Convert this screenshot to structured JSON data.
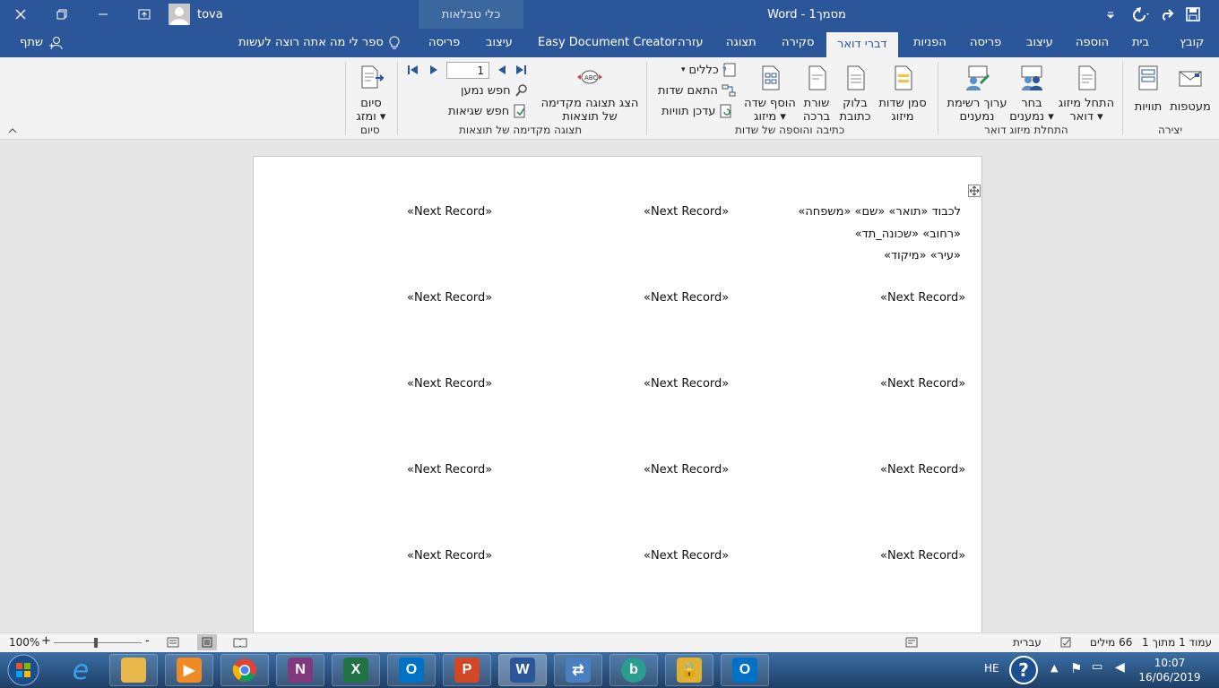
{
  "colors": {
    "accent": "#2b579a",
    "ribbon_bg": "#f3f3f3",
    "canvas_bg": "#e6e6e6"
  },
  "titlebar": {
    "doc_title": "מסמך1  -  Word",
    "context_label": "כלי טבלאות",
    "user": "tova",
    "icons": [
      "save-icon",
      "redo-icon",
      "undo-icon",
      "customize-qat-icon",
      "ribbon-options-icon",
      "minimize-icon",
      "restore-icon",
      "close-icon"
    ]
  },
  "tabs": {
    "file": "קובץ",
    "home": "בית",
    "insert": "הוספה",
    "design": "עיצוב",
    "layout": "פריסה",
    "references": "הפניות",
    "mailings": "דברי דואר",
    "review": "סקירה",
    "view": "תצוגה",
    "help": "עזרה",
    "addin": "Easy Document Creator",
    "table_design": "עיצוב",
    "table_layout": "פריסה",
    "tell_me": "ספר לי מה אתה רוצה לעשות",
    "share": "שתף"
  },
  "ribbon": {
    "envelopes": "מעטפות",
    "labels": "תוויות",
    "create_group": "יצירה",
    "start_merge": "התחל מיזוג",
    "start_merge2": "דואר",
    "select_recipients": "בחר",
    "select_recipients2": "נמענים",
    "edit_recipients": "ערוך רשימת",
    "edit_recipients2": "נמענים",
    "start_group": "התחלת מיזוג דואר",
    "highlight_fields": "סמן שדות",
    "highlight_fields2": "מיזוג",
    "address_block": "בלוק",
    "address_block2": "כתובת",
    "greeting_line": "שורת",
    "greeting_line2": "ברכה",
    "insert_field": "הוסף שדה",
    "insert_field2": "מיזוג",
    "rules": "כללים",
    "match_fields": "התאם שדות",
    "update_labels": "עדכן תוויות",
    "write_group": "כתיבה והוספה של שדות",
    "preview_results": "הצג תצוגה מקדימה",
    "preview_results2": "של תוצאות",
    "record_value": "1",
    "find_recipient": "חפש נמען",
    "check_errors": "חפש שגיאות",
    "preview_group": "תצוגה מקדימה של תוצאות",
    "finish_merge": "סיום",
    "finish_merge2": "ומזג",
    "finish_group": "סיום"
  },
  "document": {
    "label1_line1": "לכבוד «תואר» «שם» «משפחה»",
    "label1_line2": "«רחוב» «שכונה_תד»",
    "label1_line3": "«עיר» «מיקוד»",
    "next_record": "«Next Record»"
  },
  "status": {
    "page": "עמוד 1 מתוך 1",
    "words": "66 מילים",
    "language": "עברית",
    "zoom": "100%"
  },
  "taskbar": {
    "lang": "HE",
    "time": "10:07",
    "date": "16/06/2019"
  }
}
